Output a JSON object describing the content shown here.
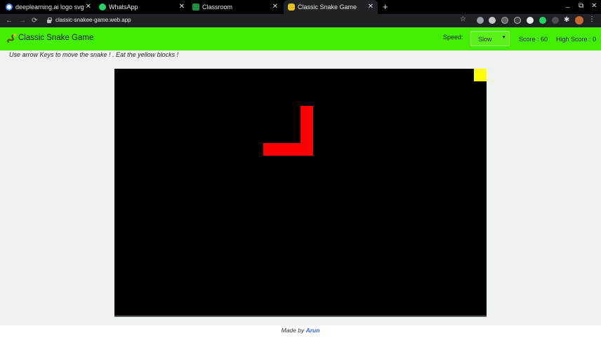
{
  "browser": {
    "tabs": [
      {
        "title": "deeplearning.ai logo svg",
        "favicon": "google-icon",
        "color": "#ffffff"
      },
      {
        "title": "WhatsApp",
        "favicon": "whatsapp-icon",
        "color": "#25d366"
      },
      {
        "title": "Classroom",
        "favicon": "classroom-icon",
        "color": "#1e8e3e"
      },
      {
        "title": "Classic Snake Game",
        "favicon": "snake-icon",
        "color": "#e3c21b"
      }
    ],
    "new_tab": "+",
    "url": "classic-snakee-game.web.app",
    "minimize": "_",
    "restore": "⧉",
    "close": "✕"
  },
  "app": {
    "title": "Classic Snake Game",
    "speed_label": "Speed:",
    "speed_value": "Slow",
    "score_text": "Score : 60",
    "high_score_text": "High Score : 0",
    "instructions": "Use arrow Keys to move the snake ! . Eat the yellow blocks !",
    "footer_prefix": "Made by ",
    "footer_author": "Arun"
  },
  "game": {
    "grid_columns": 30,
    "grid_rows": 20,
    "snake_color": "#ff0000",
    "food_color": "#ffff00",
    "board_color": "#000000",
    "snake_cells": [
      [
        15,
        3
      ],
      [
        15,
        4
      ],
      [
        15,
        5
      ],
      [
        15,
        6
      ],
      [
        14,
        6
      ],
      [
        13,
        6
      ],
      [
        12,
        6
      ]
    ],
    "food_cell": [
      29,
      0
    ]
  },
  "colors": {
    "header": "#44ee00",
    "page_bg": "#eef3f0"
  }
}
